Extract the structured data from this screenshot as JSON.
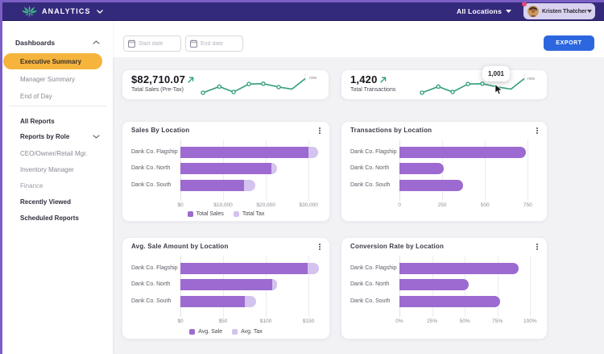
{
  "topbar": {
    "brand": "ANALYTICS",
    "location_selector": "All Locations",
    "user_name": "Kristen Thatcher"
  },
  "sidebar": {
    "rows": [
      {
        "type": "section",
        "label": "Dashboards",
        "chevron": "up"
      },
      {
        "type": "active",
        "label": "Executive Summary"
      },
      {
        "type": "item",
        "label": "Manager Summary"
      },
      {
        "type": "item",
        "label": "End of Day"
      },
      {
        "type": "divider"
      },
      {
        "type": "bold",
        "label": "All Reports"
      },
      {
        "type": "bold",
        "label": "Reports by Role",
        "chevron": "down"
      },
      {
        "type": "item",
        "label": "CEO/Owner/Retail Mgr."
      },
      {
        "type": "item",
        "label": "Inventory Manager"
      },
      {
        "type": "item",
        "label": "Finance",
        "muted": true
      },
      {
        "type": "bold",
        "label": "Recently Viewed"
      },
      {
        "type": "bold",
        "label": "Scheduled Reports"
      }
    ]
  },
  "toolbar": {
    "start_date_placeholder": "Start date",
    "end_date_placeholder": "End date",
    "export_label": "EXPORT"
  },
  "kpis": [
    {
      "value": "$82,710.07",
      "label": "Total Sales (Pre-Tax)",
      "trend": "up",
      "now_label": "now"
    },
    {
      "value": "1,420",
      "label": "Total Transactions",
      "trend": "up",
      "now_label": "now",
      "tooltip_value": "1,001"
    }
  ],
  "sparkline": {
    "x": [
      0,
      0.16,
      0.3,
      0.45,
      0.59,
      0.74,
      0.87,
      1
    ],
    "v": [
      0.03,
      0.45,
      0.08,
      0.63,
      0.65,
      0.42,
      0.28,
      1
    ],
    "marker_count": 6,
    "color": "#2f9e77"
  },
  "chart_data": [
    {
      "type": "bar",
      "orientation": "horizontal",
      "stacked": true,
      "title": "Sales By Location",
      "categories": [
        "Dank Co. Flagship",
        "Dank Co. North",
        "Dank Co. South"
      ],
      "series": [
        {
          "name": "Total Sales",
          "values": [
            30000,
            21200,
            14950
          ],
          "color": "#9c6ad0"
        },
        {
          "name": "Total Tax",
          "values": [
            2200,
            1450,
            2650
          ],
          "color": "#d3c3ee"
        }
      ],
      "x_ticks": [
        0,
        10000,
        20000,
        30000
      ],
      "x_tick_labels": [
        "$0",
        "$10,000",
        "$20,000",
        "$30,000"
      ],
      "axis_max": 32800,
      "legend": true,
      "grid": true
    },
    {
      "type": "bar",
      "orientation": "horizontal",
      "stacked": false,
      "title": "Transactions by Location",
      "categories": [
        "Dank Co. Flagship",
        "Dank Co. North",
        "Dank Co. South"
      ],
      "series": [
        {
          "name": "Transactions",
          "values": [
            740,
            260,
            370
          ],
          "color": "#9c6ad0"
        }
      ],
      "x_ticks": [
        0,
        250,
        500,
        750
      ],
      "x_tick_labels": [
        "0",
        "250",
        "500",
        "750"
      ],
      "axis_max": 810,
      "legend": false,
      "grid": true
    },
    {
      "type": "bar",
      "orientation": "horizontal",
      "stacked": true,
      "title": "Avg. Sale Amount by Location",
      "categories": [
        "Dank Co. Flagship",
        "Dank Co. North",
        "Dank Co. South"
      ],
      "series": [
        {
          "name": "Avg. Sale",
          "values": [
            149,
            107,
            75
          ],
          "color": "#9c6ad0"
        },
        {
          "name": "Avg. Tax",
          "values": [
            13,
            6,
            14
          ],
          "color": "#d3c3ee"
        }
      ],
      "x_ticks": [
        0,
        50,
        100,
        150
      ],
      "x_tick_labels": [
        "$0",
        "$50",
        "$100",
        "$150"
      ],
      "axis_max": 164,
      "legend": true,
      "grid": true
    },
    {
      "type": "bar",
      "orientation": "horizontal",
      "stacked": false,
      "title": "Conversion Rate by Location",
      "categories": [
        "Dank Co. Flagship",
        "Dank Co. North",
        "Dank Co. South"
      ],
      "series": [
        {
          "name": "Conversion Rate",
          "values": [
            91,
            53,
            77
          ],
          "color": "#9c6ad0"
        }
      ],
      "x_ticks": [
        0,
        25,
        50,
        75,
        100
      ],
      "x_tick_labels": [
        "0%",
        "25%",
        "50%",
        "75%",
        "100%"
      ],
      "axis_max": 106,
      "legend": false,
      "grid": true
    }
  ],
  "colors": {
    "topbar_bg": "#342a7c",
    "accent_border": "#7b5fc5",
    "active_item_bg": "#f6b43c",
    "export_button": "#2c67df",
    "bar_primary": "#9c6ad0",
    "bar_secondary": "#d3c3ee",
    "sparkline": "#2f9e77",
    "main_bg": "#f2f1f4",
    "notification_dot": "#e8486f"
  }
}
